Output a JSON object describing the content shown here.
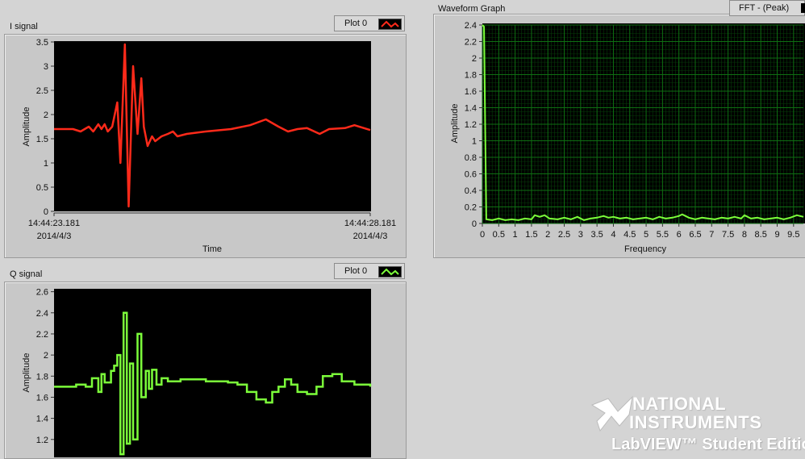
{
  "colors": {
    "i_trace": "#ff2a1a",
    "q_trace": "#7cff3a",
    "fft_trace": "#7cff3a",
    "fft_grid": "#0e6e12",
    "plot_bg": "#000000"
  },
  "i_graph": {
    "title": "I signal",
    "legend": "Plot 0",
    "xlabel": "Time",
    "ylabel": "Amplitude",
    "x_start_time": "14:44:23.181",
    "x_start_date": "2014/4/3",
    "x_end_time": "14:44:28.181",
    "x_end_date": "2014/4/3"
  },
  "q_graph": {
    "title": "Q signal",
    "legend": "Plot 0",
    "ylabel": "Amplitude"
  },
  "fft_graph": {
    "title": "Waveform Graph",
    "legend": "FFT - (Peak)",
    "xlabel": "Frequency",
    "ylabel": "Amplitude"
  },
  "watermark": {
    "line1": "NATIONAL",
    "line2": "INSTRUMENTS",
    "line3": "LabVIEW™ Student Edition"
  },
  "chart_data": [
    {
      "type": "line",
      "title": "I signal",
      "xlabel": "Time",
      "ylabel": "Amplitude",
      "xlim": [
        0,
        5
      ],
      "ylim": [
        0,
        3.5
      ],
      "yticks": [
        "0",
        "0.5",
        "1",
        "1.5",
        "2",
        "2.5",
        "3",
        "3.5"
      ],
      "series": [
        {
          "values": [
            [
              0,
              1.7
            ],
            [
              0.3,
              1.7
            ],
            [
              0.42,
              1.65
            ],
            [
              0.55,
              1.75
            ],
            [
              0.62,
              1.65
            ],
            [
              0.7,
              1.8
            ],
            [
              0.75,
              1.7
            ],
            [
              0.8,
              1.8
            ],
            [
              0.85,
              1.65
            ],
            [
              0.92,
              1.75
            ],
            [
              1.0,
              2.25
            ],
            [
              1.05,
              1.0
            ],
            [
              1.12,
              3.45
            ],
            [
              1.18,
              0.1
            ],
            [
              1.25,
              3.0
            ],
            [
              1.32,
              1.6
            ],
            [
              1.38,
              2.75
            ],
            [
              1.42,
              1.75
            ],
            [
              1.48,
              1.35
            ],
            [
              1.55,
              1.55
            ],
            [
              1.6,
              1.45
            ],
            [
              1.7,
              1.55
            ],
            [
              1.8,
              1.6
            ],
            [
              1.88,
              1.65
            ],
            [
              1.95,
              1.55
            ],
            [
              2.1,
              1.6
            ],
            [
              2.4,
              1.65
            ],
            [
              2.8,
              1.7
            ],
            [
              3.1,
              1.78
            ],
            [
              3.35,
              1.9
            ],
            [
              3.55,
              1.75
            ],
            [
              3.7,
              1.65
            ],
            [
              3.85,
              1.7
            ],
            [
              4.0,
              1.72
            ],
            [
              4.2,
              1.6
            ],
            [
              4.35,
              1.7
            ],
            [
              4.6,
              1.72
            ],
            [
              4.75,
              1.78
            ],
            [
              5.0,
              1.68
            ]
          ]
        }
      ]
    },
    {
      "type": "line",
      "title": "Q signal",
      "ylabel": "Amplitude",
      "ylim": [
        1.03,
        2.62
      ],
      "yticks": [
        "1.2",
        "1.4",
        "1.6",
        "1.8",
        "2",
        "2.2",
        "2.4",
        "2.6"
      ],
      "series": [
        {
          "values": [
            [
              0,
              1.7
            ],
            [
              0.35,
              1.72
            ],
            [
              0.5,
              1.7
            ],
            [
              0.6,
              1.78
            ],
            [
              0.7,
              1.65
            ],
            [
              0.75,
              1.82
            ],
            [
              0.8,
              1.74
            ],
            [
              0.9,
              1.85
            ],
            [
              0.95,
              1.9
            ],
            [
              1.0,
              2.0
            ],
            [
              1.05,
              1.06
            ],
            [
              1.1,
              2.4
            ],
            [
              1.15,
              1.16
            ],
            [
              1.2,
              1.92
            ],
            [
              1.25,
              1.2
            ],
            [
              1.32,
              2.2
            ],
            [
              1.38,
              1.6
            ],
            [
              1.45,
              1.85
            ],
            [
              1.5,
              1.68
            ],
            [
              1.55,
              1.86
            ],
            [
              1.62,
              1.72
            ],
            [
              1.7,
              1.78
            ],
            [
              1.8,
              1.75
            ],
            [
              2.0,
              1.77
            ],
            [
              2.4,
              1.75
            ],
            [
              2.75,
              1.74
            ],
            [
              2.9,
              1.72
            ],
            [
              3.05,
              1.65
            ],
            [
              3.2,
              1.58
            ],
            [
              3.35,
              1.55
            ],
            [
              3.45,
              1.65
            ],
            [
              3.55,
              1.7
            ],
            [
              3.65,
              1.77
            ],
            [
              3.75,
              1.72
            ],
            [
              3.85,
              1.65
            ],
            [
              4.0,
              1.63
            ],
            [
              4.15,
              1.7
            ],
            [
              4.25,
              1.8
            ],
            [
              4.4,
              1.82
            ],
            [
              4.55,
              1.75
            ],
            [
              4.75,
              1.72
            ],
            [
              5.0,
              1.7
            ]
          ]
        }
      ]
    },
    {
      "type": "line",
      "title": "Waveform Graph",
      "xlabel": "Frequency",
      "ylabel": "Amplitude",
      "xlim": [
        0,
        9.8
      ],
      "ylim": [
        0,
        2.4
      ],
      "xticks": [
        "0",
        "0.5",
        "1",
        "1.5",
        "2",
        "2.5",
        "3",
        "3.5",
        "4",
        "4.5",
        "5",
        "5.5",
        "6",
        "6.5",
        "7",
        "7.5",
        "8",
        "8.5",
        "9",
        "9.5"
      ],
      "yticks": [
        "0",
        "0.2",
        "0.4",
        "0.6",
        "0.8",
        "1",
        "1.2",
        "1.4",
        "1.6",
        "1.8",
        "2",
        "2.2",
        "2.4"
      ],
      "series": [
        {
          "name": "FFT - (Peak)",
          "values": [
            [
              0,
              2.4
            ],
            [
              0.05,
              2.38
            ],
            [
              0.12,
              0.05
            ],
            [
              0.3,
              0.04
            ],
            [
              0.5,
              0.06
            ],
            [
              0.7,
              0.04
            ],
            [
              0.9,
              0.05
            ],
            [
              1.1,
              0.04
            ],
            [
              1.3,
              0.06
            ],
            [
              1.5,
              0.05
            ],
            [
              1.6,
              0.1
            ],
            [
              1.75,
              0.08
            ],
            [
              1.9,
              0.1
            ],
            [
              2.05,
              0.06
            ],
            [
              2.3,
              0.05
            ],
            [
              2.5,
              0.07
            ],
            [
              2.7,
              0.05
            ],
            [
              2.9,
              0.08
            ],
            [
              3.1,
              0.04
            ],
            [
              3.3,
              0.06
            ],
            [
              3.5,
              0.07
            ],
            [
              3.7,
              0.09
            ],
            [
              3.85,
              0.07
            ],
            [
              4.0,
              0.08
            ],
            [
              4.2,
              0.06
            ],
            [
              4.4,
              0.07
            ],
            [
              4.6,
              0.05
            ],
            [
              4.8,
              0.06
            ],
            [
              5.0,
              0.07
            ],
            [
              5.2,
              0.05
            ],
            [
              5.4,
              0.08
            ],
            [
              5.6,
              0.06
            ],
            [
              5.8,
              0.07
            ],
            [
              6.0,
              0.09
            ],
            [
              6.1,
              0.11
            ],
            [
              6.3,
              0.07
            ],
            [
              6.5,
              0.05
            ],
            [
              6.7,
              0.07
            ],
            [
              6.9,
              0.06
            ],
            [
              7.1,
              0.05
            ],
            [
              7.3,
              0.07
            ],
            [
              7.5,
              0.06
            ],
            [
              7.7,
              0.08
            ],
            [
              7.9,
              0.06
            ],
            [
              8.0,
              0.1
            ],
            [
              8.2,
              0.06
            ],
            [
              8.4,
              0.07
            ],
            [
              8.6,
              0.05
            ],
            [
              8.8,
              0.06
            ],
            [
              9.0,
              0.07
            ],
            [
              9.2,
              0.05
            ],
            [
              9.4,
              0.07
            ],
            [
              9.6,
              0.1
            ],
            [
              9.8,
              0.08
            ]
          ]
        }
      ]
    }
  ]
}
